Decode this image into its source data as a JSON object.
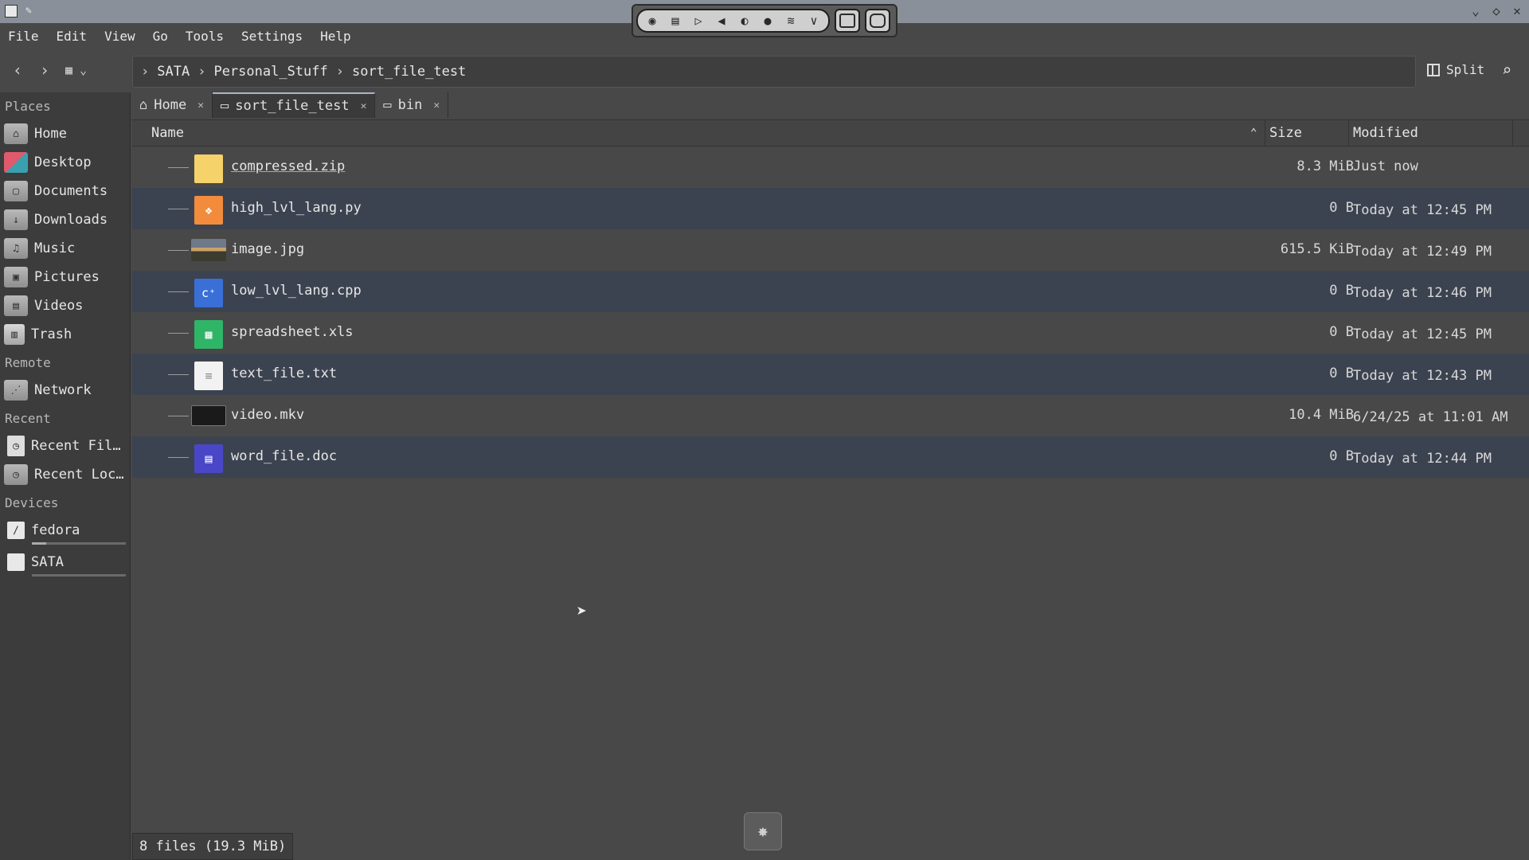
{
  "menu": [
    "File",
    "Edit",
    "View",
    "Go",
    "Tools",
    "Settings",
    "Help"
  ],
  "toolbar": {
    "back_icon": "arrow-left-icon",
    "forward_icon": "arrow-right-icon",
    "view_mode_icon": "view-mode-icon",
    "breadcrumb": [
      "SATA",
      "Personal_Stuff",
      "sort_file_test"
    ],
    "split_label": "Split",
    "search_icon": "search-icon"
  },
  "sidebar": {
    "places_label": "Places",
    "places": [
      {
        "label": "Home",
        "icon": "home-folder-icon"
      },
      {
        "label": "Desktop",
        "icon": "desktop-icon"
      },
      {
        "label": "Documents",
        "icon": "documents-folder-icon"
      },
      {
        "label": "Downloads",
        "icon": "downloads-folder-icon"
      },
      {
        "label": "Music",
        "icon": "music-folder-icon"
      },
      {
        "label": "Pictures",
        "icon": "pictures-folder-icon"
      },
      {
        "label": "Videos",
        "icon": "videos-folder-icon"
      },
      {
        "label": "Trash",
        "icon": "trash-icon"
      }
    ],
    "remote_label": "Remote",
    "remote": [
      {
        "label": "Network",
        "icon": "network-folder-icon"
      }
    ],
    "recent_label": "Recent",
    "recent": [
      {
        "label": "Recent Fil…",
        "icon": "recent-files-icon"
      },
      {
        "label": "Recent Loc…",
        "icon": "recent-locations-icon"
      }
    ],
    "devices_label": "Devices",
    "devices": [
      {
        "label": "fedora",
        "icon": "drive-icon",
        "usage": 0.15
      },
      {
        "label": "SATA",
        "icon": "drive-icon",
        "usage": 0.0
      }
    ]
  },
  "tabs": [
    {
      "label": "Home",
      "icon": "home-icon",
      "active": false
    },
    {
      "label": "sort_file_test",
      "icon": "folder-icon",
      "active": true
    },
    {
      "label": "bin",
      "icon": "folder-icon",
      "active": false
    }
  ],
  "columns": {
    "name": "Name",
    "size": "Size",
    "modified": "Modified"
  },
  "files": [
    {
      "name": "compressed.zip",
      "size": "8.3 MiB",
      "modified": "Just now",
      "icon": "zip-file-icon"
    },
    {
      "name": "high_lvl_lang.py",
      "size": "0 B",
      "modified": "Today at 12:45 PM",
      "icon": "python-file-icon"
    },
    {
      "name": "image.jpg",
      "size": "615.5 KiB",
      "modified": "Today at 12:49 PM",
      "icon": "image-thumbnail-icon"
    },
    {
      "name": "low_lvl_lang.cpp",
      "size": "0 B",
      "modified": "Today at 12:46 PM",
      "icon": "cpp-file-icon"
    },
    {
      "name": "spreadsheet.xls",
      "size": "0 B",
      "modified": "Today at 12:45 PM",
      "icon": "spreadsheet-file-icon"
    },
    {
      "name": "text_file.txt",
      "size": "0 B",
      "modified": "Today at 12:43 PM",
      "icon": "text-file-icon"
    },
    {
      "name": "video.mkv",
      "size": "10.4 MiB",
      "modified": "6/24/25 at 11:01 AM",
      "icon": "video-thumbnail-icon"
    },
    {
      "name": "word_file.doc",
      "size": "0 B",
      "modified": "Today at 12:44 PM",
      "icon": "document-file-icon"
    }
  ],
  "status": "8 files (19.3 MiB)",
  "tray_icons": [
    "screenshot-icon",
    "clipboard-icon",
    "play-icon",
    "volume-icon",
    "shield-icon",
    "microphone-icon",
    "wifi-icon",
    "chevron-down-icon",
    "window-icon",
    "settings-panel-icon"
  ],
  "colors": {
    "alt_row": "#3c4350",
    "background": "#484848",
    "sidebar": "#3c3c3c"
  }
}
